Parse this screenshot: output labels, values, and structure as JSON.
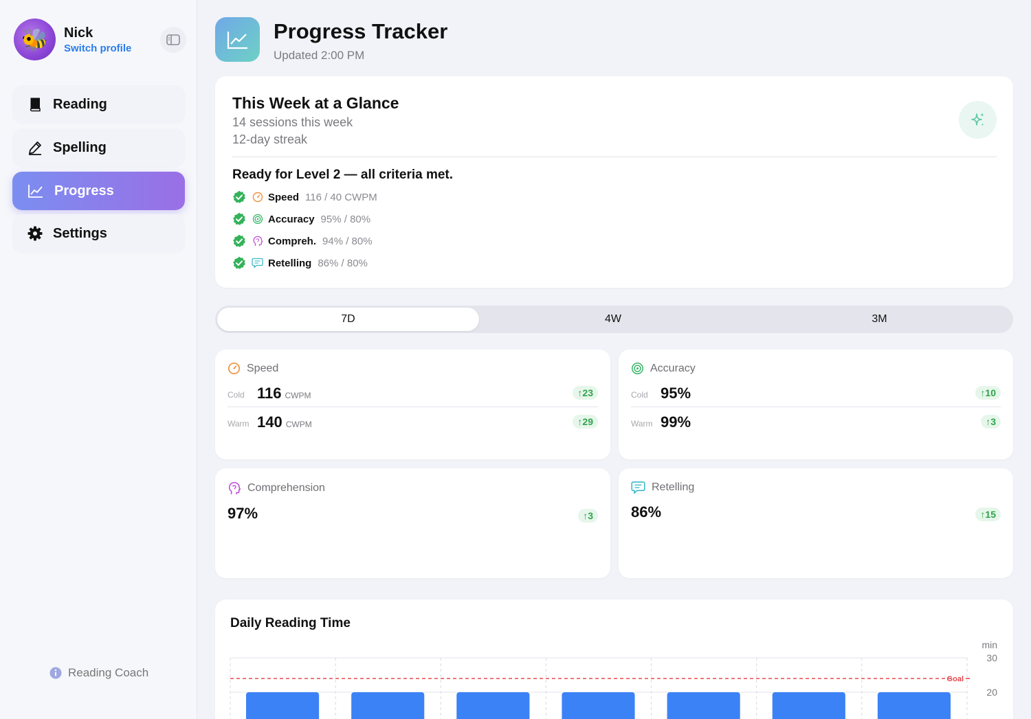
{
  "profile": {
    "name": "Nick",
    "switch_label": "Switch profile",
    "avatar_emoji": "🐝"
  },
  "sidebar": {
    "items": [
      {
        "label": "Reading",
        "icon": "book-icon",
        "active": false
      },
      {
        "label": "Spelling",
        "icon": "pencil-icon",
        "active": false
      },
      {
        "label": "Progress",
        "icon": "chart-line-icon",
        "active": true
      },
      {
        "label": "Settings",
        "icon": "gear-icon",
        "active": false
      }
    ],
    "footer_label": "Reading Coach"
  },
  "header": {
    "title": "Progress Tracker",
    "updated": "Updated 2:00 PM"
  },
  "glance": {
    "title": "This Week at a Glance",
    "sessions": "14 sessions this week",
    "streak": "12-day streak",
    "ready": "Ready for Level 2 — all criteria met.",
    "criteria": [
      {
        "name": "Speed",
        "value": "116 / 40 CWPM",
        "icon": "speedometer-icon"
      },
      {
        "name": "Accuracy",
        "value": "95% / 80%",
        "icon": "target-icon"
      },
      {
        "name": "Compreh.",
        "value": "94% / 80%",
        "icon": "head-icon"
      },
      {
        "name": "Retelling",
        "value": "86% / 80%",
        "icon": "speech-bubble-icon"
      }
    ]
  },
  "segments": {
    "items": [
      "7D",
      "4W",
      "3M"
    ],
    "selected": "7D"
  },
  "metrics": {
    "speed": {
      "title": "Speed",
      "cold": {
        "label": "Cold",
        "value": "116",
        "unit": "CWPM",
        "delta": "23"
      },
      "warm": {
        "label": "Warm",
        "value": "140",
        "unit": "CWPM",
        "delta": "29"
      }
    },
    "accuracy": {
      "title": "Accuracy",
      "cold": {
        "label": "Cold",
        "value": "95%",
        "delta": "10"
      },
      "warm": {
        "label": "Warm",
        "value": "99%",
        "delta": "3"
      }
    },
    "comprehension": {
      "title": "Comprehension",
      "value": "97%",
      "delta": "3"
    },
    "retelling": {
      "title": "Retelling",
      "value": "86%",
      "delta": "15"
    }
  },
  "colors": {
    "accent_blue": "#3b82f6",
    "goal_red": "#e5484d",
    "check_green": "#34b25a",
    "speed_orange": "#f0913a",
    "accuracy_green": "#3ab56a",
    "comprehension_purple": "#c04fd8",
    "retelling_teal": "#3bb8c9"
  },
  "chart_data": {
    "type": "bar",
    "title": "Daily Reading Time",
    "ylabel": "min",
    "y_ticks": [
      30,
      20
    ],
    "goal": {
      "label": "Goal",
      "value": 24
    },
    "values": [
      20,
      20,
      20,
      20,
      20,
      20,
      20
    ],
    "bar_color": "#3b82f6"
  }
}
